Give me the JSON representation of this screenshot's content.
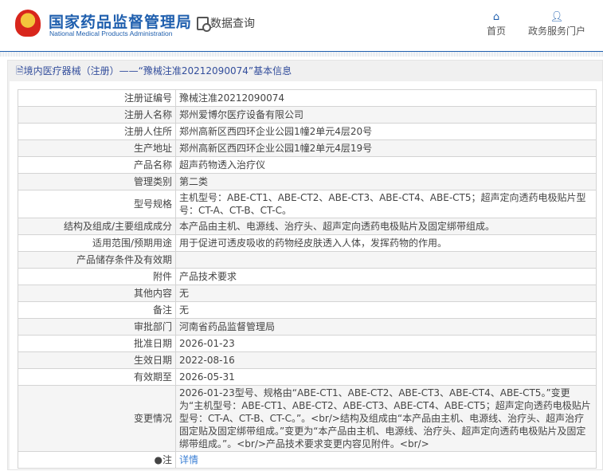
{
  "header": {
    "logo_cn": "国家药品监督管理局",
    "logo_en": "National Medical Products Administration",
    "data_query": "数据查询",
    "nav": [
      {
        "label": "首页",
        "icon": "home-icon"
      },
      {
        "label": "政务服务门户",
        "icon": "user-icon"
      }
    ]
  },
  "page_title": "境内医疗器械（注册）——“豫械注准20212090074”基本信息",
  "rows": [
    {
      "label": "注册证编号",
      "value": "豫械注准20212090074"
    },
    {
      "label": "注册人名称",
      "value": "郑州爱博尔医疗设备有限公司"
    },
    {
      "label": "注册人住所",
      "value": "郑州高新区西四环企业公园1幢2单元4层20号"
    },
    {
      "label": "生产地址",
      "value": "郑州高新区西四环企业公园1幢2单元4层19号"
    },
    {
      "label": "产品名称",
      "value": "超声药物透入治疗仪"
    },
    {
      "label": "管理类别",
      "value": "第二类"
    },
    {
      "label": "型号规格",
      "value": "主机型号：ABE-CT1、ABE-CT2、ABE-CT3、ABE-CT4、ABE-CT5；超声定向透药电极贴片型号：CT-A、CT-B、CT-C。"
    },
    {
      "label": "结构及组成/主要组成成分",
      "value": "本产品由主机、电源线、治疗头、超声定向透药电极贴片及固定绑带组成。"
    },
    {
      "label": "适用范围/预期用途",
      "value": "用于促进可透皮吸收的药物经皮肤透入人体，发挥药物的作用。"
    },
    {
      "label": "产品储存条件及有效期",
      "value": ""
    },
    {
      "label": "附件",
      "value": "产品技术要求"
    },
    {
      "label": "其他内容",
      "value": "无"
    },
    {
      "label": "备注",
      "value": "无"
    },
    {
      "label": "审批部门",
      "value": "河南省药品监督管理局"
    },
    {
      "label": "批准日期",
      "value": "2026-01-23"
    },
    {
      "label": "生效日期",
      "value": "2022-08-16"
    },
    {
      "label": "有效期至",
      "value": "2026-05-31"
    },
    {
      "label": "变更情况",
      "value": "2026-01-23型号、规格由“ABE-CT1、ABE-CT2、ABE-CT3、ABE-CT4、ABE-CT5。”变更为“主机型号：ABE-CT1、ABE-CT2、ABE-CT3、ABE-CT4、ABE-CT5；超声定向透药电极贴片型号：CT-A、CT-B、CT-C。”。<br/>结构及组成由“本产品由主机、电源线、治疗头、超声治疗固定贴及固定绑带组成。”变更为“本产品由主机、电源线、治疗头、超声定向透药电极贴片及固定绑带组成。”。<br/>产品技术要求变更内容见附件。<br/>"
    }
  ],
  "note": {
    "label": "注",
    "link": "详情"
  }
}
